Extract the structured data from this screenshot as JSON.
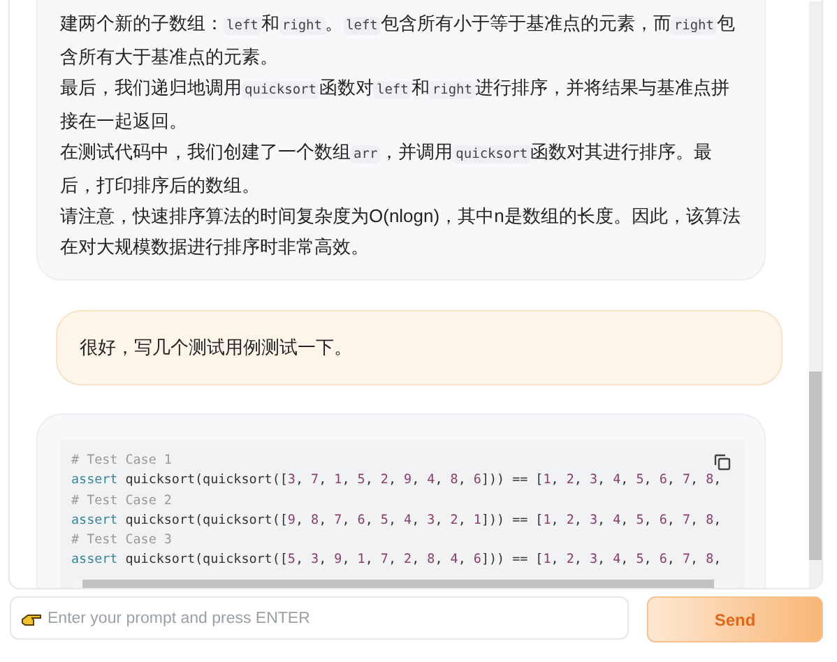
{
  "messages": [
    {
      "kind": "bot_text",
      "paragraphs": [
        [
          {
            "kind": "text",
            "text": "建两个新的子数组："
          },
          {
            "kind": "code",
            "text": "left"
          },
          {
            "kind": "text",
            "text": "和"
          },
          {
            "kind": "code",
            "text": "right"
          },
          {
            "kind": "text",
            "text": "。"
          },
          {
            "kind": "code",
            "text": "left"
          },
          {
            "kind": "text",
            "text": "包含所有小于等于基准点的元素，而"
          },
          {
            "kind": "code",
            "text": "right"
          },
          {
            "kind": "text",
            "text": "包含所有大于基准点的元素。"
          }
        ],
        [
          {
            "kind": "text",
            "text": "最后，我们递归地调用"
          },
          {
            "kind": "code",
            "text": "quicksort"
          },
          {
            "kind": "text",
            "text": "函数对"
          },
          {
            "kind": "code",
            "text": "left"
          },
          {
            "kind": "text",
            "text": "和"
          },
          {
            "kind": "code",
            "text": "right"
          },
          {
            "kind": "text",
            "text": "进行排序，并将结果与基准点拼接在一起返回。"
          }
        ],
        [
          {
            "kind": "text",
            "text": "在测试代码中，我们创建了一个数组"
          },
          {
            "kind": "code",
            "text": "arr"
          },
          {
            "kind": "text",
            "text": "，并调用"
          },
          {
            "kind": "code",
            "text": "quicksort"
          },
          {
            "kind": "text",
            "text": "函数对其进行排序。最后，打印排序后的数组。"
          }
        ],
        [
          {
            "kind": "text",
            "text": "请注意，快速排序算法的时间复杂度为O(nlogn)，其中n是数组的长度。因此，该算法在对大规模数据进行排序时非常高效。"
          }
        ]
      ]
    },
    {
      "kind": "user_text",
      "text": "很好，写几个测试用例测试一下。"
    },
    {
      "kind": "bot_code",
      "lines": [
        [
          {
            "kind": "comment",
            "text": "# Test Case 1"
          }
        ],
        [
          {
            "kind": "keyword",
            "text": "assert"
          },
          {
            "kind": "plain",
            "text": " quicksort(quicksort([3, 7, 1, 5, 2, 9, 4, 8, 6])) == [1, 2, 3, 4, 5, 6, 7, 8,"
          }
        ],
        [
          {
            "kind": "comment",
            "text": "# Test Case 2"
          }
        ],
        [
          {
            "kind": "keyword",
            "text": "assert"
          },
          {
            "kind": "plain",
            "text": " quicksort(quicksort([9, 8, 7, 6, 5, 4, 3, 2, 1])) == [1, 2, 3, 4, 5, 6, 7, 8,"
          }
        ],
        [
          {
            "kind": "comment",
            "text": "# Test Case 3"
          }
        ],
        [
          {
            "kind": "keyword",
            "text": "assert"
          },
          {
            "kind": "plain",
            "text": " quicksort(quicksort([5, 3, 9, 1, 7, 2, 8, 4, 6])) == [1, 2, 3, 4, 5, 6, 7, 8,"
          }
        ]
      ]
    }
  ],
  "prompt": {
    "placeholder": "Enter your prompt and press ENTER"
  },
  "send_button": "Send"
}
